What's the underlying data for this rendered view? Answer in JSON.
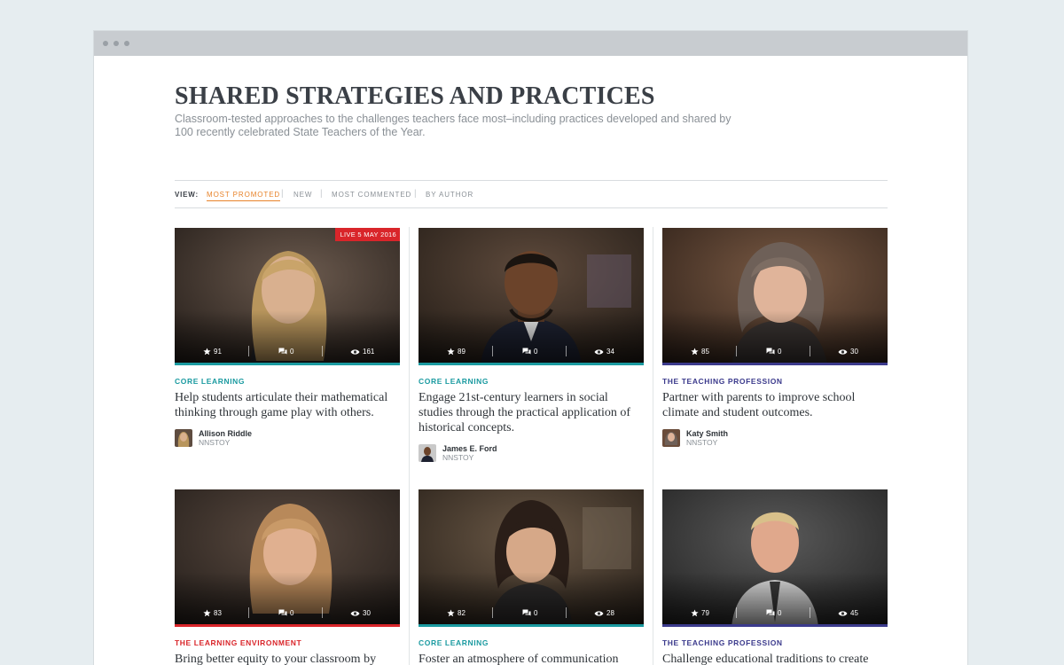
{
  "window": {
    "controls": [
      "window-dot",
      "window-dot",
      "window-dot"
    ]
  },
  "header": {
    "title": "SHARED STRATEGIES AND PRACTICES",
    "description": "Classroom-tested approaches to the challenges teachers face most–including practices developed and shared by 100 recently celebrated State Teachers of the Year."
  },
  "view": {
    "label": "VIEW:",
    "options": [
      "MOST PROMOTED",
      "NEW",
      "MOST COMMENTED",
      "BY AUTHOR"
    ],
    "active": "MOST PROMOTED"
  },
  "colors": {
    "core_learning": "#1a9aa0",
    "teaching_profession": "#3b3a8c",
    "learning_environment": "#d9252a",
    "active_view": "#e8832a"
  },
  "cards": [
    {
      "live_badge": "LIVE 5 MAY 2016",
      "stats": {
        "stars": "91",
        "comments": "0",
        "views": "161"
      },
      "category": "CORE LEARNING",
      "title": "Help students articulate their mathematical thinking through game play with others.",
      "author": {
        "name": "Allison Riddle",
        "org": "NNSTOY"
      }
    },
    {
      "stats": {
        "stars": "89",
        "comments": "0",
        "views": "34"
      },
      "category": "CORE LEARNING",
      "title": "Engage 21st-century learners in social studies through the practical application of historical concepts.",
      "author": {
        "name": "James E. Ford",
        "org": "NNSTOY"
      }
    },
    {
      "stats": {
        "stars": "85",
        "comments": "0",
        "views": "30"
      },
      "category": "THE TEACHING PROFESSION",
      "title": "Partner with parents to improve school climate and student outcomes.",
      "author": {
        "name": "Katy Smith",
        "org": "NNSTOY"
      }
    },
    {
      "stats": {
        "stars": "83",
        "comments": "0",
        "views": "30"
      },
      "category": "THE LEARNING ENVIRONMENT",
      "title": "Bring better equity to your classroom by"
    },
    {
      "stats": {
        "stars": "82",
        "comments": "0",
        "views": "28"
      },
      "category": "CORE LEARNING",
      "title": "Foster an atmosphere of communication"
    },
    {
      "stats": {
        "stars": "79",
        "comments": "0",
        "views": "45"
      },
      "category": "THE TEACHING PROFESSION",
      "title": "Challenge educational traditions to create"
    }
  ]
}
